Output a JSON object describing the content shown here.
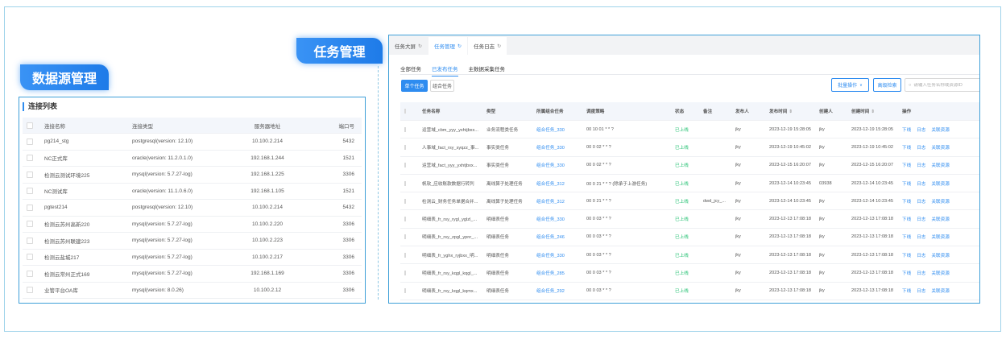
{
  "badges": {
    "datasource": "数据源管理",
    "task": "任务管理"
  },
  "connections": {
    "title": "连接列表",
    "headers": [
      "连接名称",
      "连接类型",
      "服务器地址",
      "端口号"
    ],
    "rows": [
      [
        "pg214_stg",
        "postgresql(version: 12.10)",
        "10.100.2.214",
        "5432"
      ],
      [
        "NC正式库",
        "oracle(version: 11.2.0.1.0)",
        "192.168.1.244",
        "1521"
      ],
      [
        "检测云测试环境225",
        "mysql(version: 5.7.27-log)",
        "192.168.1.225",
        "3306"
      ],
      [
        "NC测试库",
        "oracle(version: 11.1.0.6.0)",
        "192.168.1.105",
        "1521"
      ],
      [
        "pgtest214",
        "postgresql(version: 12.10)",
        "10.100.2.214",
        "5432"
      ],
      [
        "检测云苏州高新220",
        "mysql(version: 5.7.27-log)",
        "10.100.2.220",
        "3306"
      ],
      [
        "检测云苏州联建223",
        "mysql(version: 5.7.27-log)",
        "10.100.2.223",
        "3306"
      ],
      [
        "检测云盐城217",
        "mysql(version: 5.7.27-log)",
        "10.100.2.217",
        "3306"
      ],
      [
        "检测云常州正式169",
        "mysql(version: 5.7.27-log)",
        "192.168.1.169",
        "3306"
      ],
      [
        "业管平台OA库",
        "mysql(version: 8.0.26)",
        "10.100.2.12",
        "3306"
      ]
    ]
  },
  "tasks": {
    "tabs": [
      {
        "label": "任务大屏",
        "icon": "refresh-icon"
      },
      {
        "label": "任务管理",
        "icon": "refresh-icon"
      },
      {
        "label": "任务日志",
        "icon": "refresh-icon"
      }
    ],
    "subtabs": [
      "全部任务",
      "已发布任务",
      "主数据采集任务"
    ],
    "btn_single": "单个任务",
    "btn_group": "组合任务",
    "btn_batch": "批量操作",
    "btn_adv": "高级检索",
    "search_placeholder": "请输入任务名称或资源ID",
    "headers": {
      "name": "任务名称",
      "type": "类型",
      "group": "所属组合任务",
      "cron": "调度策略",
      "status": "状态",
      "note": "备注",
      "publisher": "发布人",
      "ptime": "发布时间",
      "creator": "创建人",
      "ctime": "创建时间",
      "ops": "操作"
    },
    "ops": [
      "下线",
      "日志",
      "关联资源"
    ],
    "rows": [
      {
        "name": "运营域_cbm_yyy_yxhtjbxx...",
        "type": "业务流程类任务",
        "group": "组合任务_330",
        "cron": "00 10 01 * * ?",
        "status": "已上线",
        "note": "",
        "publisher": "jky",
        "ptime": "2023-12-19 15:28:05",
        "creator": "jky",
        "ctime": "2023-12-19 15:28:05"
      },
      {
        "name": "人事域_fact_rsy_syqzz_事...",
        "type": "事实类任务",
        "group": "组合任务_330",
        "cron": "00 0 02 * * ?",
        "status": "已上线",
        "note": "",
        "publisher": "jky",
        "ptime": "2023-12-19 10:45:02",
        "creator": "jky",
        "ctime": "2023-12-19 10:45:02"
      },
      {
        "name": "运营域_fact_yyy_yxhtjbxx...",
        "type": "事实类任务",
        "group": "组合任务_330",
        "cron": "00 0 02 * * ?",
        "status": "已上线",
        "note": "",
        "publisher": "jky",
        "ptime": "2023-12-15 16:20:07",
        "creator": "jky",
        "ctime": "2023-12-15 16:20:07"
      },
      {
        "name": "帆软_应收账款数据行转列",
        "type": "离线算子处理任务",
        "group": "组合任务_312",
        "cron": "00 0 21 * * ? (除承于上游任务)",
        "status": "已上线",
        "note": "",
        "publisher": "jky",
        "ptime": "2023-12-14 10:23:45",
        "creator": "03938",
        "ctime": "2023-12-14 10:23:45"
      },
      {
        "name": "检测云_财务任务单据合并...",
        "type": "离线算子处理任务",
        "group": "组合任务_312",
        "cron": "00 0 21 * * ?",
        "status": "已上线",
        "note": "dwd_jcy_...",
        "publisher": "jky",
        "ptime": "2023-12-14 10:23:45",
        "creator": "jky",
        "ctime": "2023-12-14 10:23:45"
      },
      {
        "name": "明细表_fr_rsy_rygl_yglzl_...",
        "type": "明细表任务",
        "group": "组合任务_330",
        "cron": "00 0 03 * * ?",
        "status": "已上线",
        "note": "",
        "publisher": "jky",
        "ptime": "2023-12-13 17:08:18",
        "creator": "jky",
        "ctime": "2023-12-13 17:08:18"
      },
      {
        "name": "明细表_fr_rsy_zpgl_ypnr_...",
        "type": "明细表任务",
        "group": "组合任务_246",
        "cron": "00 0 03 * * ?",
        "status": "已上线",
        "note": "",
        "publisher": "jky",
        "ptime": "2023-12-13 17:08:18",
        "creator": "jky",
        "ctime": "2023-12-13 17:08:18"
      },
      {
        "name": "明细表_fr_yghx_ryjbxx_明...",
        "type": "明细表任务",
        "group": "组合任务_330",
        "cron": "00 0 03 * * ?",
        "status": "已上线",
        "note": "",
        "publisher": "jky",
        "ptime": "2023-12-13 17:08:18",
        "creator": "jky",
        "ctime": "2023-12-13 17:08:18"
      },
      {
        "name": "明细表_fr_rsy_kqgl_kqgl_...",
        "type": "明细表任务",
        "group": "组合任务_285",
        "cron": "00 0 03 * * ?",
        "status": "已上线",
        "note": "",
        "publisher": "jky",
        "ptime": "2023-12-13 17:08:18",
        "creator": "jky",
        "ctime": "2023-12-13 17:08:18"
      },
      {
        "name": "明细表_fr_rsy_kqgl_kqmx...",
        "type": "明细表任务",
        "group": "组合任务_292",
        "cron": "00 0 03 * * ?",
        "status": "已上线",
        "note": "",
        "publisher": "jky",
        "ptime": "2023-12-13 17:08:18",
        "creator": "jky",
        "ctime": "2023-12-13 17:08:18"
      }
    ]
  },
  "colors": {
    "accent": "#2e8cf0",
    "success": "#19be6b",
    "border": "#3fa0d8"
  }
}
